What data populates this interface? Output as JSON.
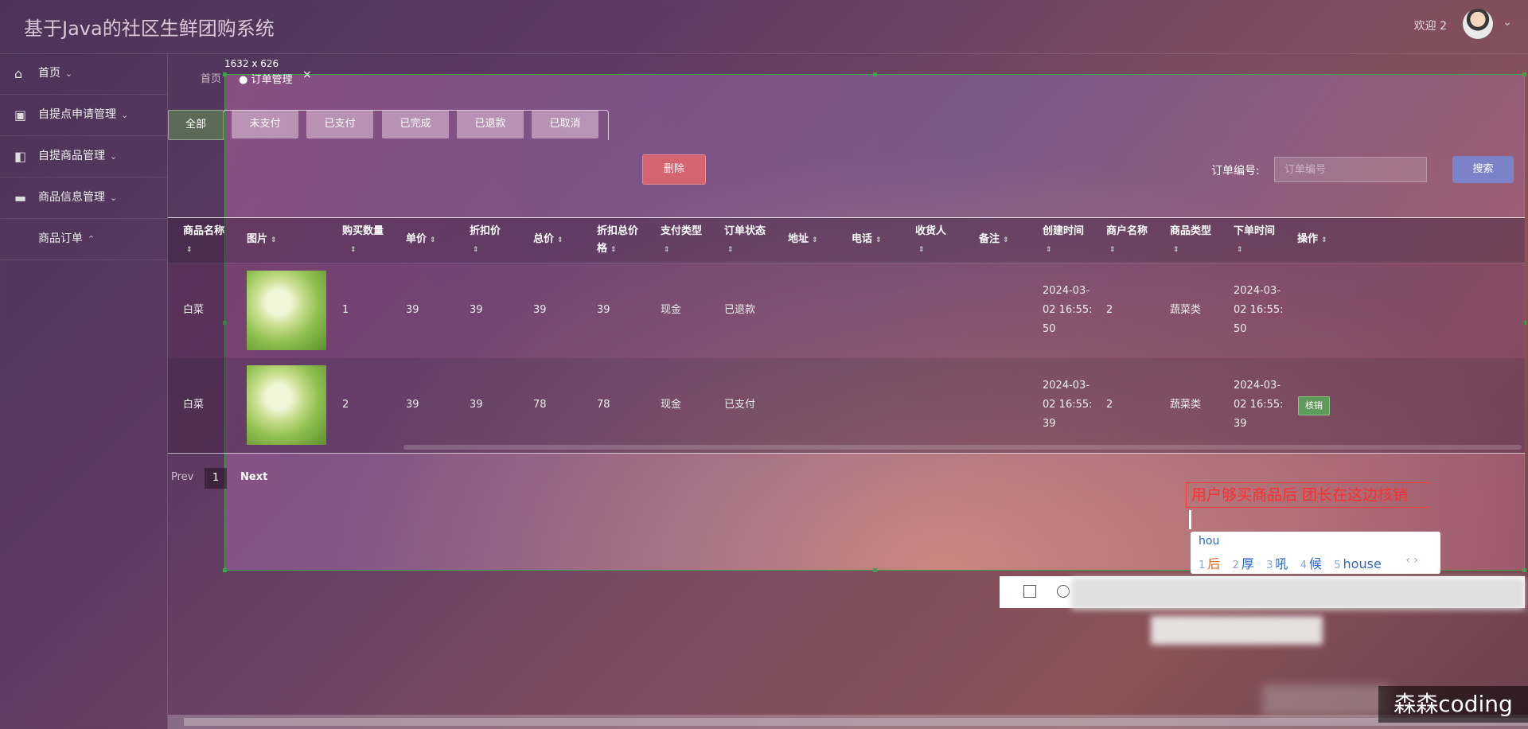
{
  "app": {
    "title": "基于Java的社区生鲜团购系统",
    "welcome": "欢迎 2"
  },
  "sidebar": {
    "items": [
      {
        "label": "首页",
        "icon": "home-icon"
      },
      {
        "label": "自提点申请管理",
        "icon": "gift-icon"
      },
      {
        "label": "自提商品管理",
        "icon": "panel-icon"
      },
      {
        "label": "商品信息管理",
        "icon": "card-icon"
      },
      {
        "label": "商品订单",
        "icon": ""
      }
    ]
  },
  "breadcrumb": {
    "home": "首页",
    "tab": "订单管理",
    "dimension": "1632 x 626"
  },
  "filters": {
    "tabs": [
      "全部",
      "未支付",
      "已支付",
      "已完成",
      "已退款",
      "已取消"
    ],
    "active": "全部"
  },
  "actions": {
    "delete": "删除",
    "search_label": "订单编号:",
    "search_placeholder": "订单编号",
    "search_button": "搜索"
  },
  "table": {
    "headers": [
      "商品名称",
      "图片",
      "购买数量",
      "单价",
      "折扣价",
      "总价",
      "折扣总价格",
      "支付类型",
      "订单状态",
      "地址",
      "电话",
      "收货人",
      "备注",
      "创建时间",
      "商户名称",
      "商品类型",
      "下单时间",
      "操作"
    ],
    "rows": [
      {
        "name": "白菜",
        "qty": "1",
        "price": "39",
        "discount": "39",
        "total": "39",
        "discount_total": "39",
        "pay_type": "现金",
        "status": "已退款",
        "created": [
          "2024-03-",
          "02 16:55:",
          "50"
        ],
        "merchant": "2",
        "type": "蔬菜类",
        "ordered": [
          "2024-03-",
          "02 16:55:",
          "50"
        ],
        "op": ""
      },
      {
        "name": "白菜",
        "qty": "2",
        "price": "39",
        "discount": "39",
        "total": "78",
        "discount_total": "78",
        "pay_type": "现金",
        "status": "已支付",
        "created": [
          "2024-03-",
          "02 16:55:",
          "39"
        ],
        "merchant": "2",
        "type": "蔬菜类",
        "ordered": [
          "2024-03-",
          "02 16:55:",
          "39"
        ],
        "op": "核销"
      }
    ]
  },
  "pager": {
    "prev": "Prev",
    "page": "1",
    "next": "Next"
  },
  "annotation": "用户够买商品后 团长在这边核销",
  "ime": {
    "input": "hou",
    "candidates": [
      {
        "n": "1",
        "w": "后"
      },
      {
        "n": "2",
        "w": "厚"
      },
      {
        "n": "3",
        "w": "吼"
      },
      {
        "n": "4",
        "w": "候"
      },
      {
        "n": "5",
        "w": "house"
      }
    ]
  },
  "watermark": "森森coding"
}
